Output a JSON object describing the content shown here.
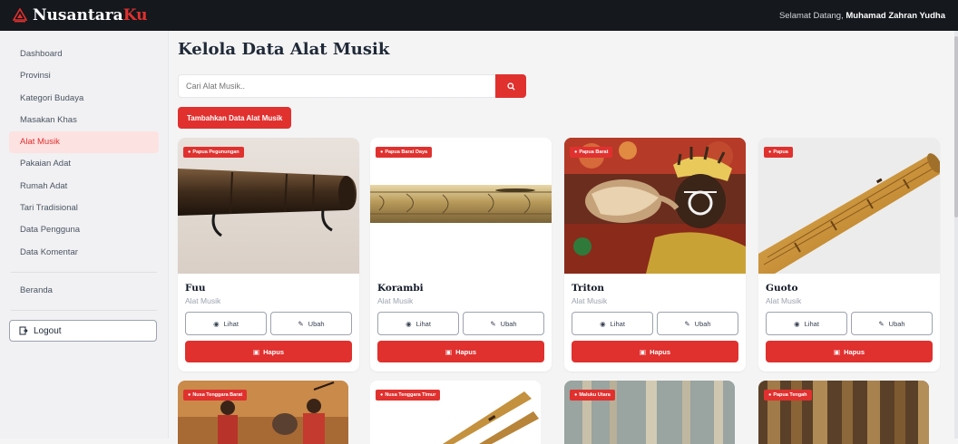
{
  "brand": {
    "name": "Nusantara",
    "accent": "Ku"
  },
  "header": {
    "greeting": "Selamat Datang,",
    "user": "Muhamad Zahran Yudha"
  },
  "sidebar": {
    "items": [
      {
        "label": "Dashboard"
      },
      {
        "label": "Provinsi"
      },
      {
        "label": "Kategori Budaya"
      },
      {
        "label": "Masakan Khas"
      },
      {
        "label": "Alat Musik"
      },
      {
        "label": "Pakaian Adat"
      },
      {
        "label": "Rumah Adat"
      },
      {
        "label": "Tari Tradisional"
      },
      {
        "label": "Data Pengguna"
      },
      {
        "label": "Data Komentar"
      }
    ],
    "beranda": "Beranda",
    "logout": "Logout"
  },
  "main": {
    "title": "Kelola Data Alat Musik",
    "search_placeholder": "Cari Alat Musik..",
    "add_button": "Tambahkan Data Alat Musik"
  },
  "cards": [
    {
      "region": "Papua Pegunungan",
      "name": "Fuu",
      "category": "Alat Musik",
      "view": "Lihat",
      "edit": "Ubah",
      "delete": "Hapus"
    },
    {
      "region": "Papua Barat Daya",
      "name": "Korambi",
      "category": "Alat Musik",
      "view": "Lihat",
      "edit": "Ubah",
      "delete": "Hapus"
    },
    {
      "region": "Papua Barat",
      "name": "Triton",
      "category": "Alat Musik",
      "view": "Lihat",
      "edit": "Ubah",
      "delete": "Hapus"
    },
    {
      "region": "Papua",
      "name": "Guoto",
      "category": "Alat Musik",
      "view": "Lihat",
      "edit": "Ubah",
      "delete": "Hapus"
    }
  ],
  "cards_row2": [
    {
      "region": "Nusa Tenggara Barat"
    },
    {
      "region": "Nusa Tenggara Timur"
    },
    {
      "region": "Maluku Utara"
    },
    {
      "region": "Papua Tengah"
    }
  ],
  "colors": {
    "accent": "#e0312f",
    "topbar": "#15181d",
    "active_bg": "#fde2e2"
  }
}
